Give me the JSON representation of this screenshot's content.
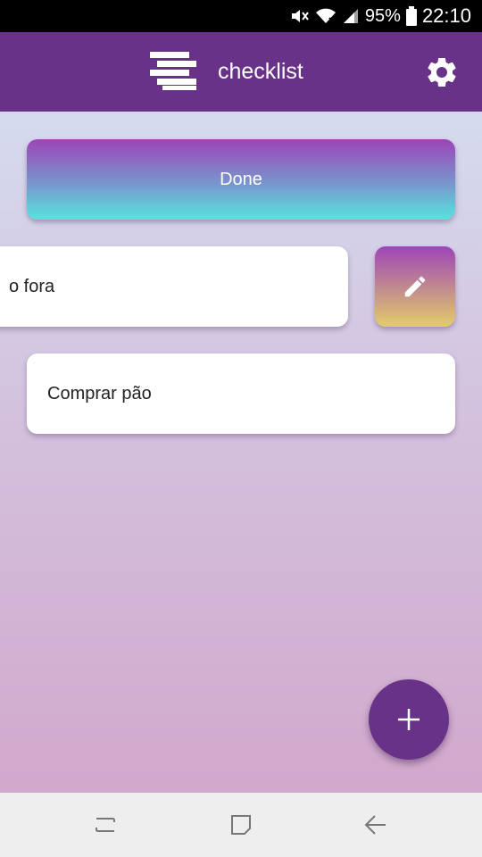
{
  "status_bar": {
    "battery": "95%",
    "time": "22:10",
    "icons": [
      "mute-icon",
      "wifi-icon",
      "signal-icon",
      "battery-icon"
    ]
  },
  "app_bar": {
    "title": "checklist",
    "icons": [
      "logo-icon",
      "gear-icon"
    ],
    "color": "#673287"
  },
  "main": {
    "done_label": "Done",
    "tasks": [
      {
        "text": "o fora"
      },
      {
        "text": "Comprar pão"
      }
    ],
    "edit_icon": "pencil-icon",
    "fab_icon": "plus-icon"
  },
  "nav_bar": {
    "icons": [
      "recents-icon",
      "home-icon",
      "back-icon"
    ]
  }
}
